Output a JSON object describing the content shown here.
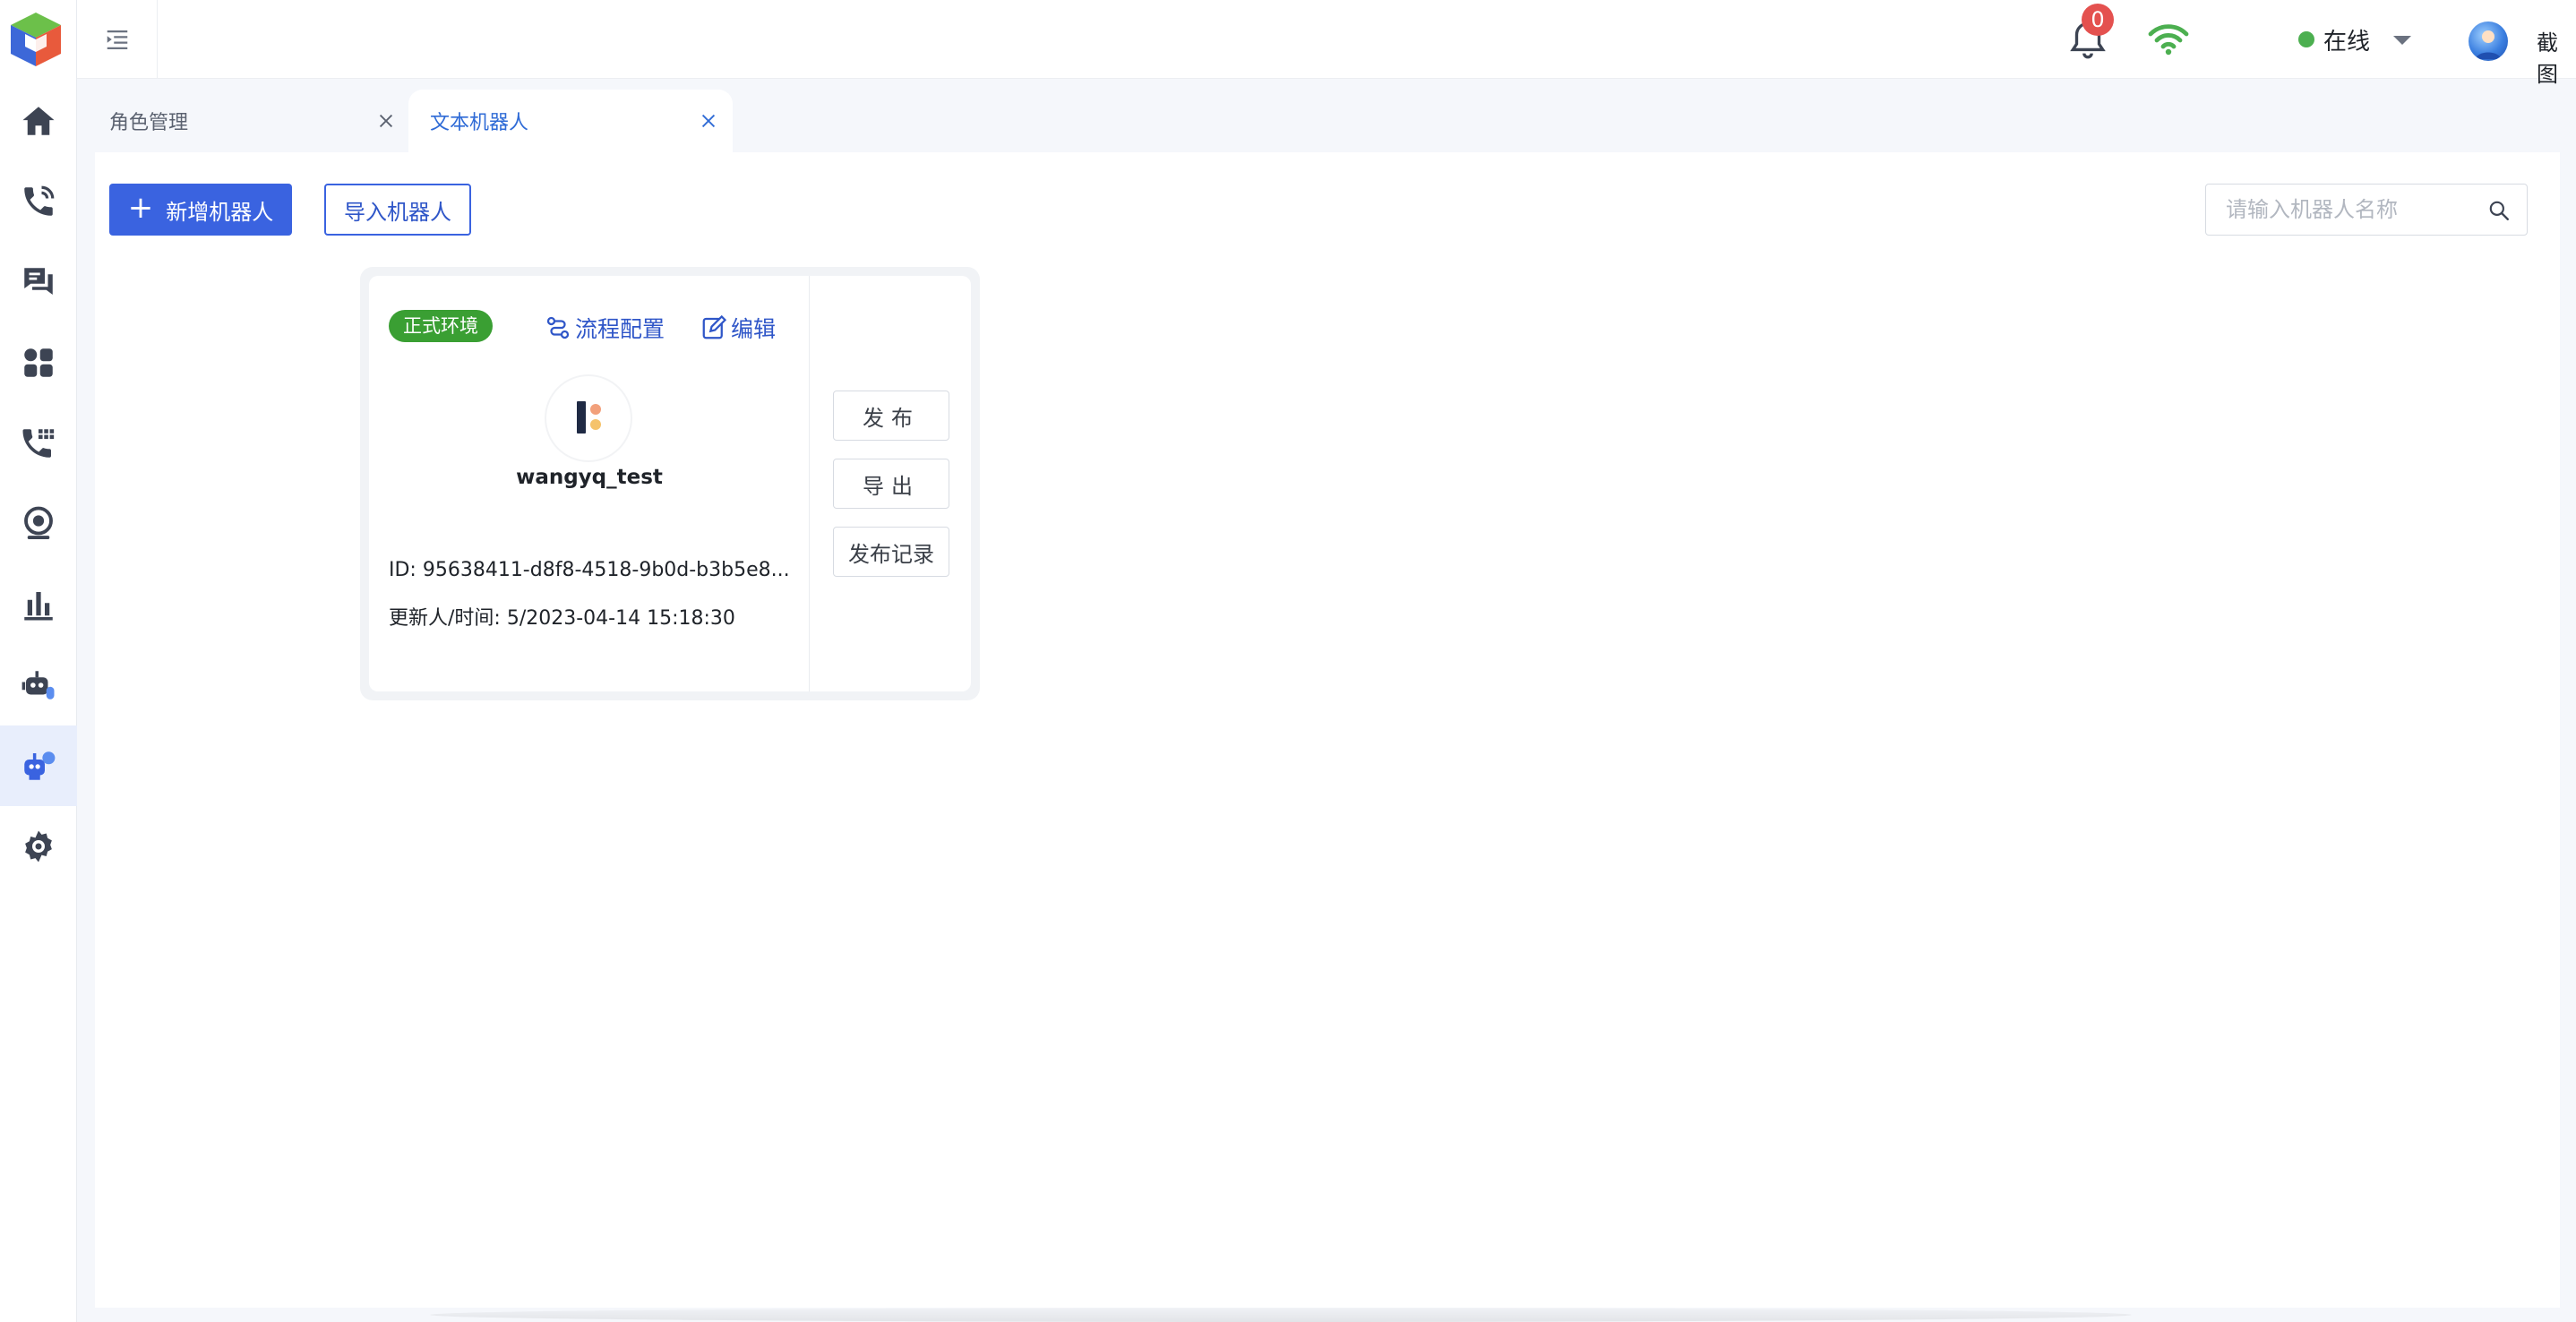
{
  "header": {
    "notification_count": "0",
    "status_label": "在线",
    "username": "截图"
  },
  "tabs": [
    {
      "label": "角色管理",
      "active": false
    },
    {
      "label": "文本机器人",
      "active": true
    }
  ],
  "toolbar": {
    "add_label": "新增机器人",
    "import_label": "导入机器人",
    "search_placeholder": "请输入机器人名称"
  },
  "card": {
    "env_tag": "正式环境",
    "flow_label": "流程配置",
    "edit_label": "编辑",
    "name": "wangyq_test",
    "id_text": "ID: 95638411-d8f8-4518-9b0d-b3b5e8...",
    "updated_text": "更新人/时间: 5/2023-04-14 15:18:30",
    "publish_label": "发布",
    "export_label": "导出",
    "history_label": "发布记录"
  },
  "colors": {
    "primary": "#3a63e0",
    "env_green": "#3a9f33",
    "badge_red": "#e4514f",
    "online_green": "#4caf50",
    "nav_active_bg": "#e8eefc"
  },
  "sidebar": {
    "items": [
      {
        "icon": "home-icon"
      },
      {
        "icon": "phone-call-icon"
      },
      {
        "icon": "chat-icon"
      },
      {
        "icon": "apps-icon"
      },
      {
        "icon": "phone-dialpad-icon"
      },
      {
        "icon": "monitor-icon"
      },
      {
        "icon": "bar-chart-icon"
      },
      {
        "icon": "voice-robot-icon"
      },
      {
        "icon": "text-robot-icon",
        "active": true
      },
      {
        "icon": "settings-icon"
      }
    ]
  }
}
